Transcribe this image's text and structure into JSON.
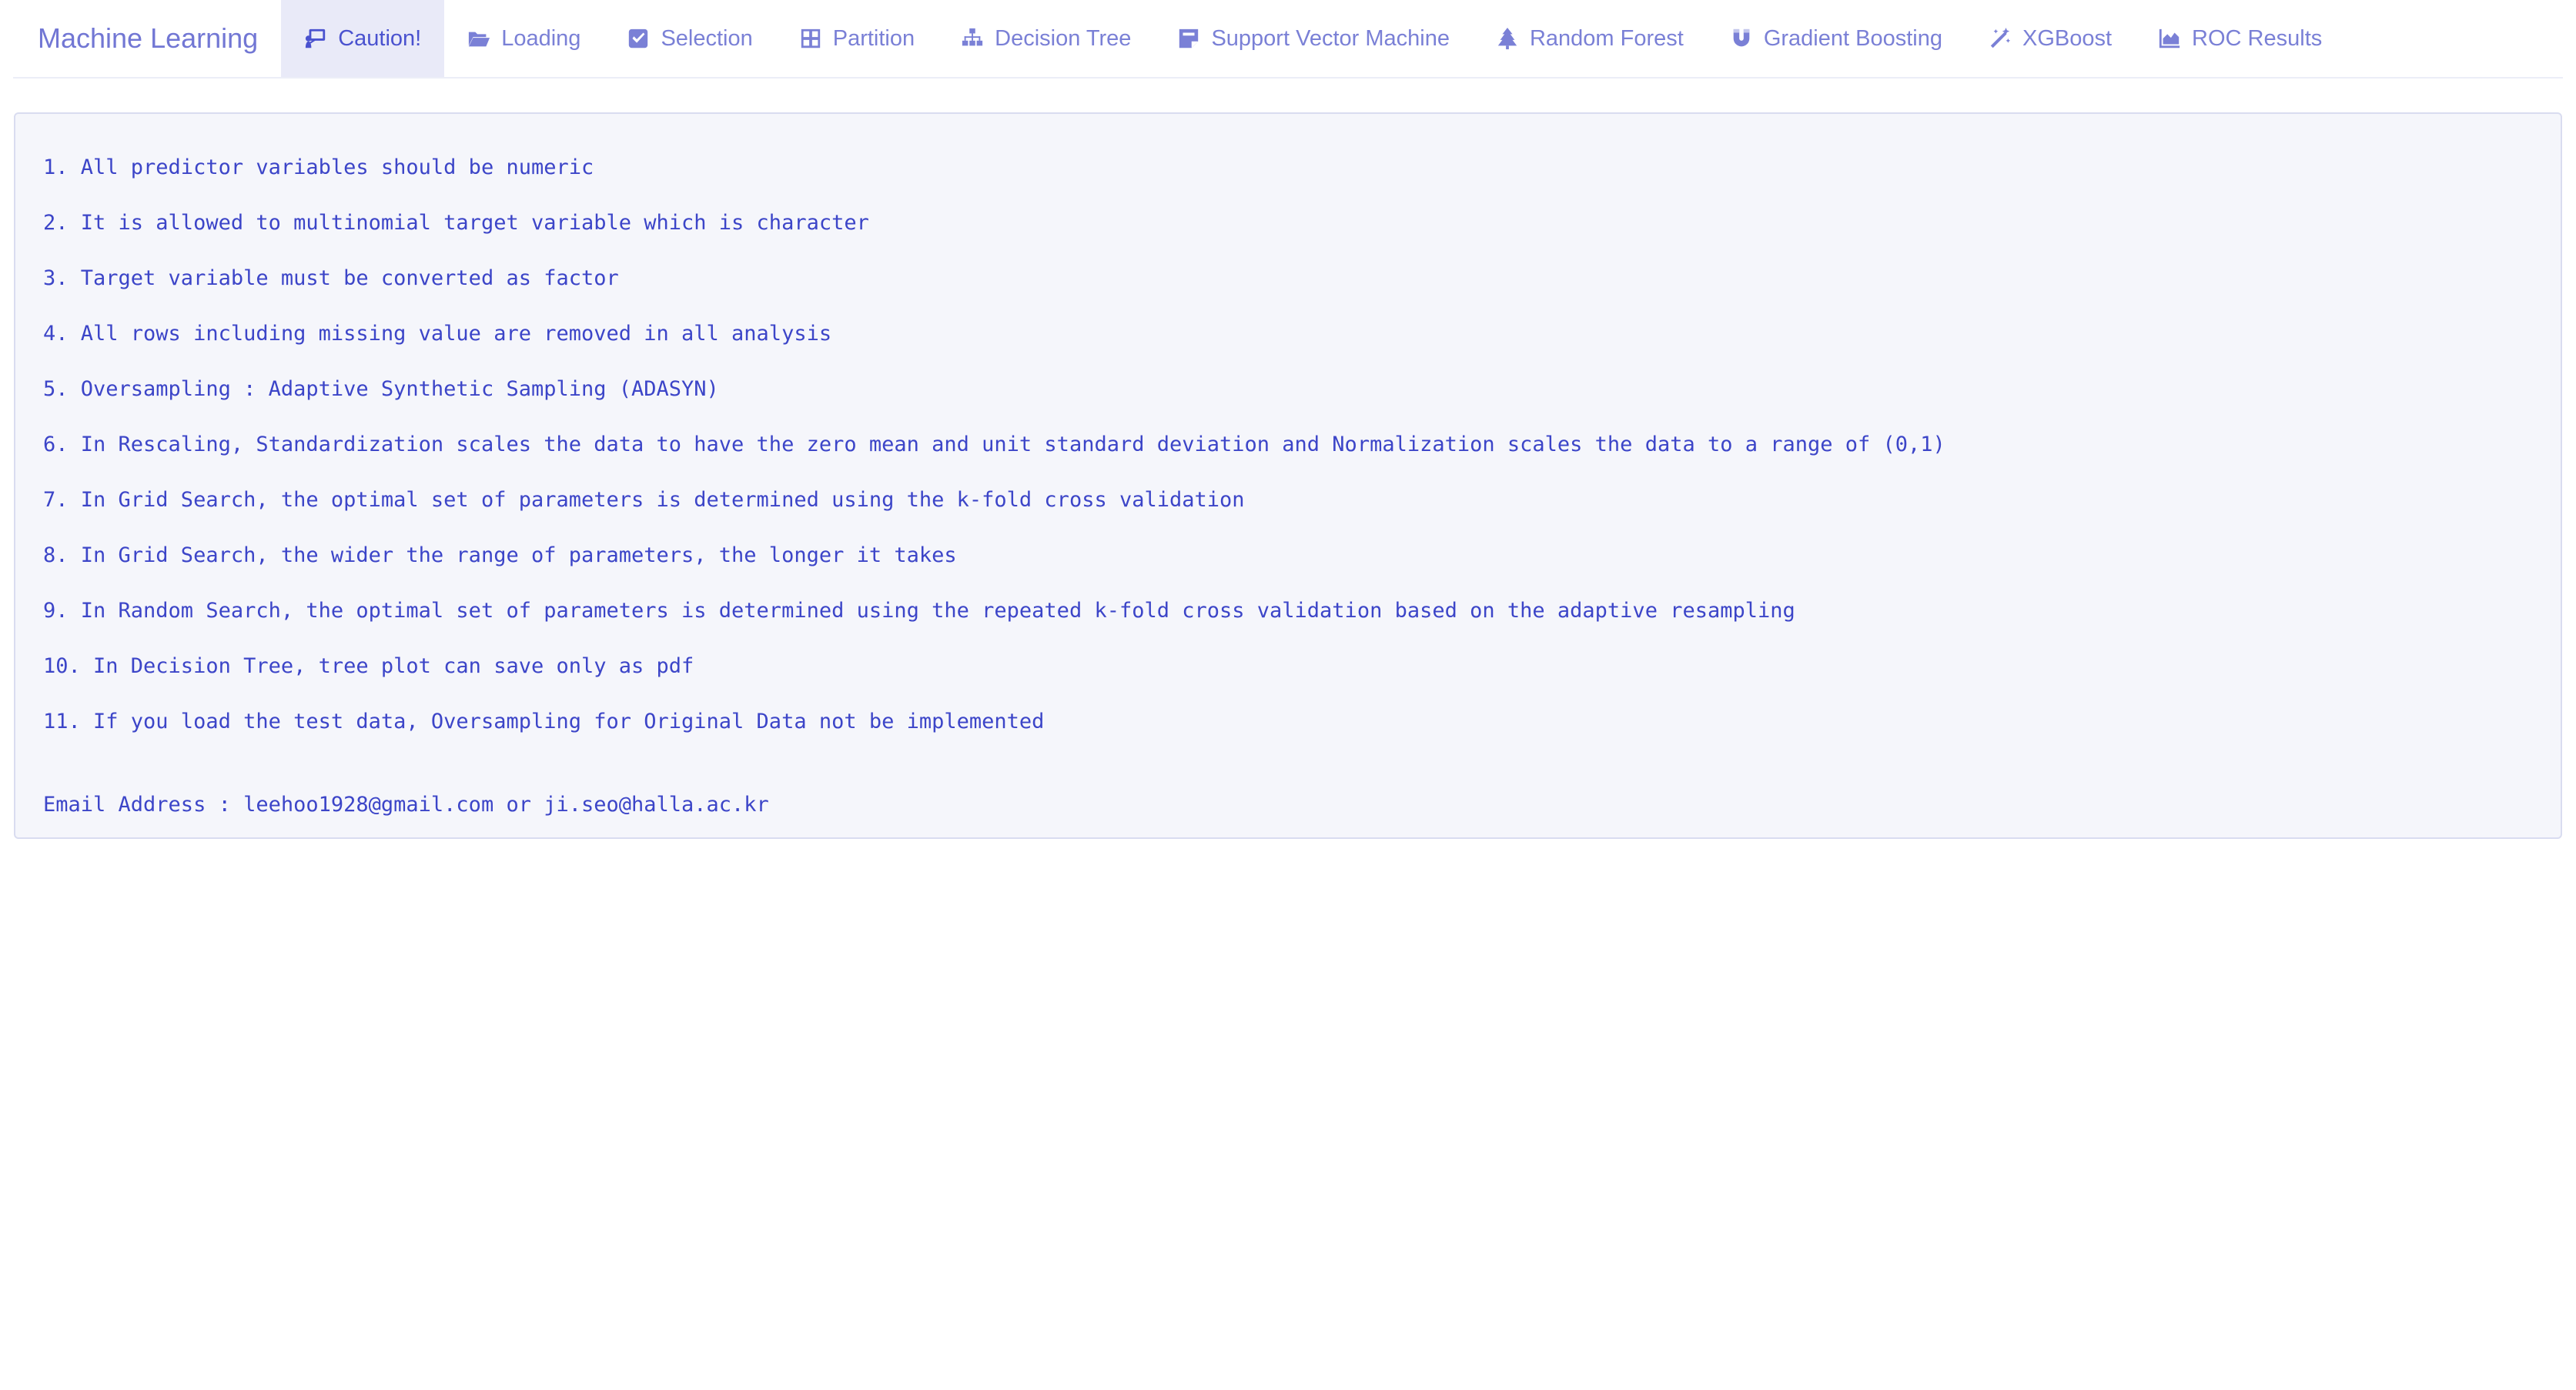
{
  "app": {
    "title": "Machine Learning"
  },
  "nav": {
    "tabs": [
      {
        "label": "Caution!",
        "icon": "caution-icon",
        "active": true
      },
      {
        "label": "Loading",
        "icon": "folder-open-icon",
        "active": false
      },
      {
        "label": "Selection",
        "icon": "check-square-icon",
        "active": false
      },
      {
        "label": "Partition",
        "icon": "grid-icon",
        "active": false
      },
      {
        "label": "Decision Tree",
        "icon": "sitemap-icon",
        "active": false
      },
      {
        "label": "Support Vector Machine",
        "icon": "sticky-note-icon",
        "active": false
      },
      {
        "label": "Random Forest",
        "icon": "tree-icon",
        "active": false
      },
      {
        "label": "Gradient Boosting",
        "icon": "magnet-icon",
        "active": false
      },
      {
        "label": "XGBoost",
        "icon": "magic-wand-icon",
        "active": false
      },
      {
        "label": "ROC Results",
        "icon": "area-chart-icon",
        "active": false
      }
    ]
  },
  "content": {
    "notes": [
      "1. All predictor variables should be numeric",
      "2. It is allowed to multinomial target variable which is character",
      "3. Target variable must be converted as factor",
      "4. All rows including missing value are removed in all analysis",
      "5. Oversampling : Adaptive Synthetic Sampling (ADASYN)",
      "6. In Rescaling, Standardization scales the data to have the zero mean and unit standard deviation and Normalization scales the data to a range of (0,1)",
      "7. In Grid Search, the optimal set of parameters is determined using the k-fold cross validation",
      "8. In Grid Search, the wider the range of parameters, the longer it takes",
      "9. In Random Search, the optimal set of parameters is determined using the repeated k-fold cross validation based on the adaptive resampling",
      "10. In Decision Tree, tree plot can save only as pdf",
      "11. If you load the test data, Oversampling for Original Data not be implemented"
    ],
    "email": "Email Address : leehoo1928@gmail.com or ji.seo@halla.ac.kr"
  },
  "colors": {
    "accent": "#4a52cf",
    "tab_text": "#7a80d6",
    "active_tab_bg": "#e9eaf8",
    "panel_bg": "#f5f6fb",
    "panel_border": "#d9dcf0"
  }
}
